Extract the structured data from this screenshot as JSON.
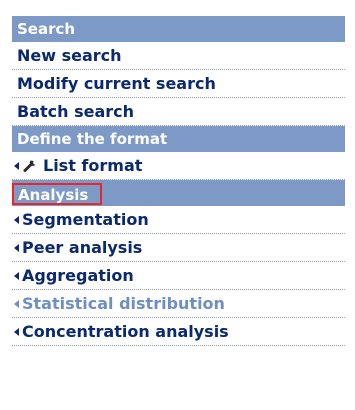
{
  "sections": {
    "search": {
      "header": "Search",
      "items": [
        "New search",
        "Modify current search",
        "Batch search"
      ]
    },
    "format": {
      "header": "Define the format",
      "items": [
        "List format"
      ]
    },
    "analysis": {
      "header": "Analysis",
      "items": [
        {
          "label": "Segmentation",
          "state": "enabled"
        },
        {
          "label": "Peer analysis",
          "state": "enabled"
        },
        {
          "label": "Aggregation",
          "state": "enabled"
        },
        {
          "label": "Statistical distribution",
          "state": "disabled"
        },
        {
          "label": "Concentration analysis",
          "state": "enabled"
        }
      ]
    }
  },
  "icons": {
    "arrow": "arrow-left-icon",
    "wrench": "wrench-icon"
  },
  "colors": {
    "header_bg": "#7d9ac6",
    "item_text": "#0b2a6e",
    "disabled_text": "#6f8fc4",
    "highlight_border": "#e8262c"
  }
}
